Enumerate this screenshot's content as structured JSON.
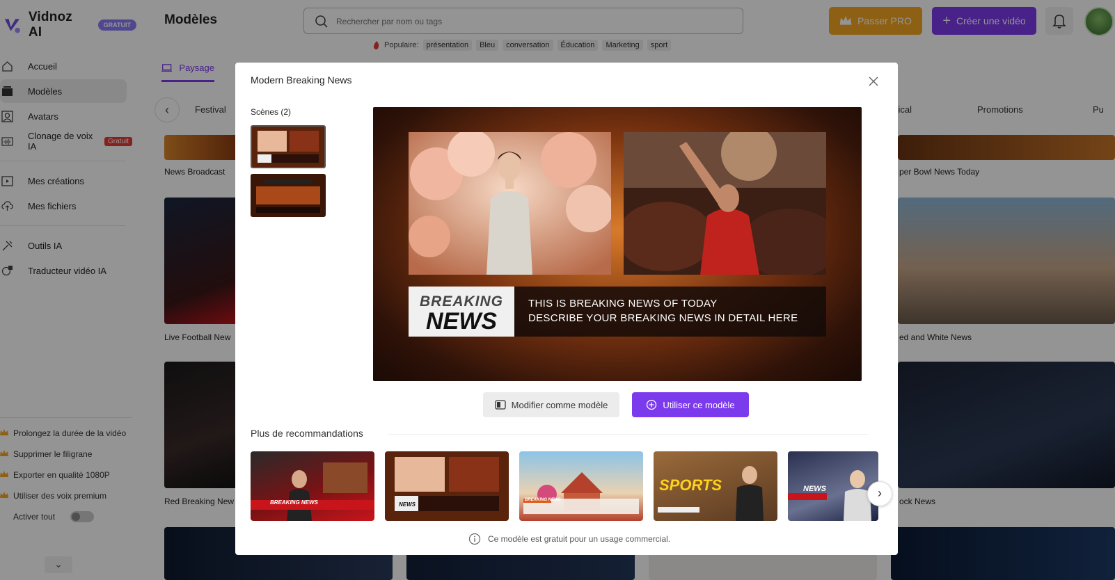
{
  "brand": {
    "name": "Vidnoz AI",
    "badge": "GRATUIT"
  },
  "sidebar": {
    "items": [
      {
        "label": "Accueil",
        "icon": "home-icon"
      },
      {
        "label": "Modèles",
        "icon": "templates-icon",
        "active": true
      },
      {
        "label": "Avatars",
        "icon": "avatar-icon"
      },
      {
        "label": "Clonage de voix IA",
        "icon": "voice-icon",
        "badge": "Gratuit"
      },
      {
        "label": "Mes créations",
        "icon": "play-icon"
      },
      {
        "label": "Mes fichiers",
        "icon": "upload-cloud-icon"
      },
      {
        "label": "Outils IA",
        "icon": "tools-icon"
      },
      {
        "label": "Traducteur vidéo IA",
        "icon": "translate-icon"
      }
    ],
    "promo": [
      "Prolongez la durée de la vidéo",
      "Supprimer le filigrane",
      "Exporter en qualité 1080P",
      "Utiliser des voix premium"
    ],
    "toggle_label": "Activer tout"
  },
  "header": {
    "title": "Modèles",
    "search_placeholder": "Rechercher par nom ou tags",
    "popular_label": "Populaire:",
    "popular_tags": [
      "présentation",
      "Bleu",
      "conversation",
      "Éducation",
      "Marketing",
      "sport"
    ],
    "pro_button": "Passer PRO",
    "create_button": "Créer une vidéo"
  },
  "tabs": {
    "active": "Paysage"
  },
  "categories": {
    "left": "Festival",
    "right_partial": "édical",
    "promotions": "Promotions",
    "far_right": "Pu"
  },
  "background_cards": {
    "left": [
      "News Broadcast",
      "Live Football New",
      "Red Breaking New"
    ],
    "right": [
      "per Bowl News Today",
      "ed and White News",
      "ock News"
    ]
  },
  "modal": {
    "title": "Modern Breaking News",
    "scenes_label": "Scènes (2)",
    "preview": {
      "breaking": "BREAKING",
      "news": "NEWS",
      "line1": "THIS IS BREAKING NEWS OF TODAY",
      "line2": "DESCRIBE YOUR BREAKING NEWS IN DETAIL HERE"
    },
    "edit_button": "Modifier comme modèle",
    "use_button": "Utiliser ce modèle",
    "reco_label": "Plus de recommandations",
    "reco_captions": [
      "BREAKING NEWS",
      "NEWS",
      "BREAKING NEWS",
      "SPORTS",
      "NEWS"
    ],
    "footer_note": "Ce modèle est gratuit pour un usage commercial."
  },
  "colors": {
    "accent": "#7c3aed",
    "pro": "#f5a623",
    "overlay": "rgba(0,0,0,0.42)"
  }
}
